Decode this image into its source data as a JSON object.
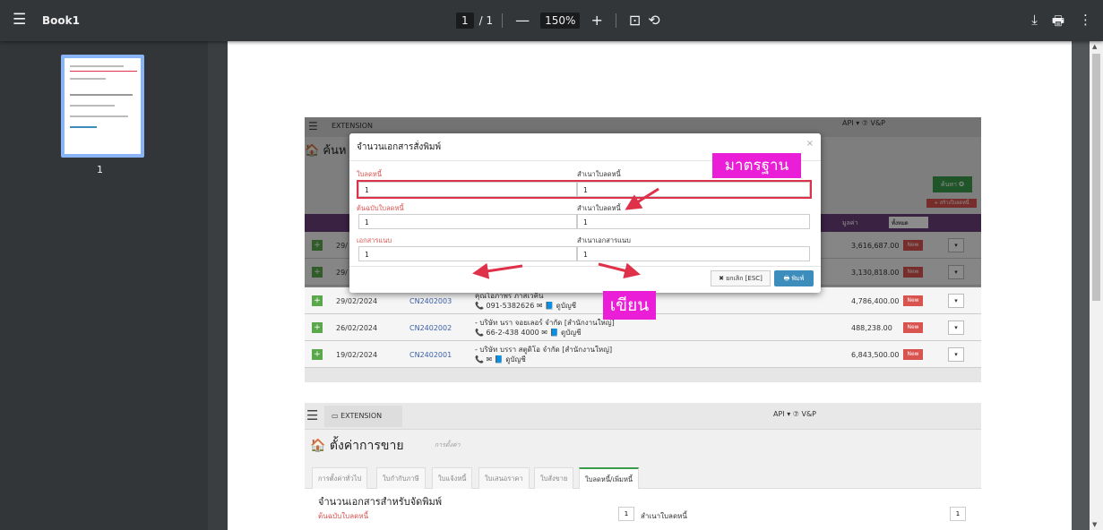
{
  "viewer": {
    "title": "Book1",
    "page_current": "1",
    "page_total": "/ 1",
    "zoom": "150%",
    "zoom_out": "—",
    "zoom_in": "+",
    "thumb_label": "1"
  },
  "shot1": {
    "ext_label": "EXTENSION",
    "top_right": "API  ▾   ⑦  V&P",
    "page_head": "ค้นห",
    "search_button": "ค้นหา ✪",
    "add_button": "+ สร้างใบลดหนี้",
    "modal": {
      "title": "จำนวนเอกสารสั่งพิมพ์",
      "close": "×",
      "f1_label": "ใบลดหนี้",
      "f1_value": "1",
      "f2_label": "สำเนาใบลดหนี้",
      "f2_value": "1",
      "f3_label": "ต้นฉบับใบลดหนี้",
      "f3_value": "1",
      "f4_label": "สำเนาใบลดหนี้",
      "f4_value": "1",
      "f5_label": "เอกสารแนบ",
      "f5_value": "1",
      "f6_label": "สำเนาเอกสารแนบ",
      "f6_value": "1",
      "cancel": "✖ ยกเลิก [ESC]",
      "print": "🖶 พิมพ์"
    },
    "tag_standard": "มาตรฐาน",
    "tag_write": "เขียน",
    "rows": [
      {
        "date": "29/02/2024",
        "code": "CN2402003",
        "name": "คุณโอภาพร ภาสเวคิน",
        "sub": "📞 091-5382626  ✉  📘 ดูบัญชี",
        "amount": "4,786,400.00",
        "badge": "New"
      },
      {
        "date": "26/02/2024",
        "code": "CN2402002",
        "name": "- บริษัท นรา จอยเลอร์ จำกัด [สำนักงานใหญ่]",
        "sub": "📞 66-2-438 4000  ✉  📘 ดูบัญชี",
        "amount": "488,238.00",
        "badge": "New"
      },
      {
        "date": "19/02/2024",
        "code": "CN2402001",
        "name": "- บริษัท บรรา สตูดิโอ จำกัด [สำนักงานใหญ่]",
        "sub": "📞  ✉  📘 ดูบัญชี",
        "amount": "6,843,500.00",
        "badge": "New"
      }
    ],
    "hidden_rows": [
      {
        "date": "29/",
        "amount": "3,616,687.00",
        "badge": "New"
      },
      {
        "date": "29/",
        "amount": "3,130,818.00",
        "badge": "New"
      }
    ],
    "col_amount": "มูลค่า",
    "col_filter": "ทั้งหมด"
  },
  "shot2": {
    "ext_label": "EXTENSION",
    "top_right": "API  ▾   ⑦  V&P",
    "title": "ตั้งค่าการขาย",
    "subtitle": "การตั้งค่า",
    "tabs": [
      "การตั้งค่าทั่วไป",
      "ใบกำกับภาษี",
      "ใบแจ้งหนี้",
      "ใบเสนอราคา",
      "ใบสั่งขาย",
      "ใบลดหนี้/เพิ่มหนี้"
    ],
    "section_title": "จำนวนเอกสารสำหรับจัดพิมพ์",
    "row_label1": "ต้นฉบับใบลดหนี้",
    "row_value1": "1",
    "row_label2": "สำเนาใบลดหนี้",
    "row_value2": "1"
  },
  "colors": {
    "accent_magenta": "#e91ed6",
    "red_frame": "#e0314a",
    "viewer_bg": "#525659"
  }
}
